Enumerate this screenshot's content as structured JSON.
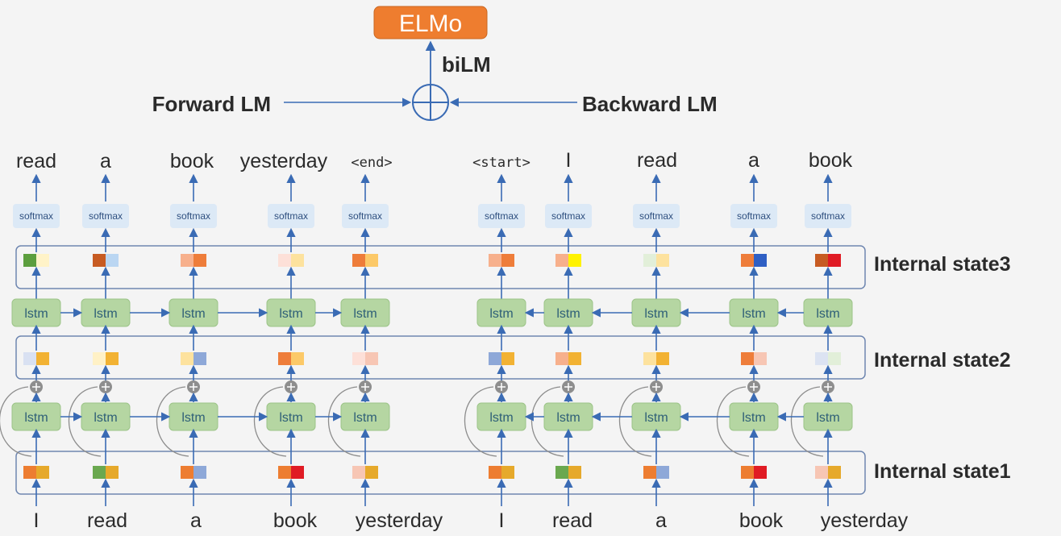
{
  "title": "ELMo",
  "combine_label": "biLM",
  "forward_label": "Forward LM",
  "backward_label": "Backward LM",
  "state_labels": [
    "Internal state3",
    "Internal state2",
    "Internal state1"
  ],
  "softmax_label": "softmax",
  "lstm_label": "lstm",
  "colors": {
    "title_bg": "#ee7d2f",
    "arrow": "#3a6bb4",
    "lstm_fill": "#b5d6a2",
    "softmax_fill": "#dce9f6",
    "panel_border": "#6e86b0"
  },
  "forward": {
    "inputs": [
      "I",
      "read",
      "a",
      "book",
      "yesterday"
    ],
    "outputs": [
      "read",
      "a",
      "book",
      "yesterday",
      "<end>"
    ],
    "state3": [
      [
        "#5c9e3e",
        "#fff3c8"
      ],
      [
        "#c75b22",
        "#bad6f2"
      ],
      [
        "#f7b08c",
        "#ee7d3a"
      ],
      [
        "#fde0d8",
        "#fde29e"
      ],
      [
        "#ee7d3a",
        "#fcc968"
      ]
    ],
    "state2": [
      [
        "#d9e1f2",
        "#f2b233"
      ],
      [
        "#fff1c6",
        "#f2b233"
      ],
      [
        "#fde29e",
        "#8ea8d8"
      ],
      [
        "#ee7d3a",
        "#fcc968"
      ],
      [
        "#fde0d8",
        "#f7c6b4"
      ]
    ],
    "state1": [
      [
        "#ed7d31",
        "#e6a92b"
      ],
      [
        "#6aa84f",
        "#e6a92b"
      ],
      [
        "#ed7d31",
        "#8ea8d8"
      ],
      [
        "#ed7d31",
        "#e01b24"
      ],
      [
        "#f7c6b4",
        "#e6a92b"
      ]
    ]
  },
  "backward": {
    "inputs": [
      "I",
      "read",
      "a",
      "book",
      "yesterday"
    ],
    "outputs": [
      "<start>",
      "I",
      "read",
      "a",
      "book"
    ],
    "state3": [
      [
        "#f7b08c",
        "#ee7d3a"
      ],
      [
        "#f7b08c",
        "#fff200"
      ],
      [
        "#e2efd9",
        "#fde29e"
      ],
      [
        "#ee7d3a",
        "#2f5fc4"
      ],
      [
        "#c75b22",
        "#e01b24"
      ]
    ],
    "state2": [
      [
        "#8ea8d8",
        "#f2b233"
      ],
      [
        "#f7b08c",
        "#f2b233"
      ],
      [
        "#fde29e",
        "#f2b233"
      ],
      [
        "#ee7d3a",
        "#f7c6b4"
      ],
      [
        "#dce3f2",
        "#e2efd9"
      ]
    ],
    "state1": [
      [
        "#ed7d31",
        "#e6a92b"
      ],
      [
        "#6aa84f",
        "#e6a92b"
      ],
      [
        "#ed7d31",
        "#8ea8d8"
      ],
      [
        "#ed7d31",
        "#e01b24"
      ],
      [
        "#f7c6b4",
        "#e6a92b"
      ]
    ]
  }
}
